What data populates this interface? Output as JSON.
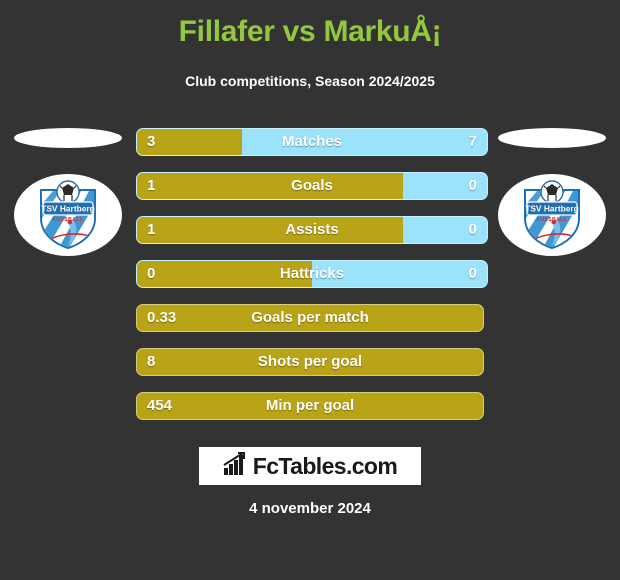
{
  "header": {
    "title": "Fillafer vs MarkuÅ¡",
    "subtitle": "Club competitions, Season 2024/2025"
  },
  "colors": {
    "background": "#333333",
    "title_green": "#93c83e",
    "bar_gold": "#b9a316",
    "bar_blue": "#9ae3fb",
    "text_white": "#ffffff"
  },
  "teams": {
    "left": {
      "name": "TSV Hartberg",
      "sub": "FUSSBALL",
      "logo_icon": "tsv-hartberg-crest-icon"
    },
    "right": {
      "name": "TSV Hartberg",
      "sub": "FUSSBALL",
      "logo_icon": "tsv-hartberg-crest-icon"
    }
  },
  "chart_data": {
    "type": "bar",
    "title": "Fillafer vs MarkuÅ¡",
    "subtitle": "Club competitions, Season 2024/2025",
    "orientation": "horizontal-diverging",
    "series": [
      {
        "name": "Fillafer",
        "color": "#b9a316",
        "align": "left"
      },
      {
        "name": "MarkuÅ¡",
        "color": "#9ae3fb",
        "align": "right"
      }
    ],
    "categories": [
      "Matches",
      "Goals",
      "Assists",
      "Hattricks",
      "Goals per match",
      "Shots per goal",
      "Min per goal"
    ],
    "rows": [
      {
        "label": "Matches",
        "left_value": "3",
        "right_value": "7",
        "left_pct": 30,
        "split": true
      },
      {
        "label": "Goals",
        "left_value": "1",
        "right_value": "0",
        "left_pct": 76,
        "split": true
      },
      {
        "label": "Assists",
        "left_value": "1",
        "right_value": "0",
        "left_pct": 76,
        "split": true
      },
      {
        "label": "Hattricks",
        "left_value": "0",
        "right_value": "0",
        "left_pct": 50,
        "split": true
      },
      {
        "label": "Goals per match",
        "left_value": "0.33",
        "right_value": "",
        "left_pct": 100,
        "split": false
      },
      {
        "label": "Shots per goal",
        "left_value": "8",
        "right_value": "",
        "left_pct": 100,
        "split": false
      },
      {
        "label": "Min per goal",
        "left_value": "454",
        "right_value": "",
        "left_pct": 100,
        "split": false
      }
    ]
  },
  "footer": {
    "brand": "FcTables.com",
    "brand_icon": "bar-chart-icon",
    "date": "4 november 2024"
  }
}
